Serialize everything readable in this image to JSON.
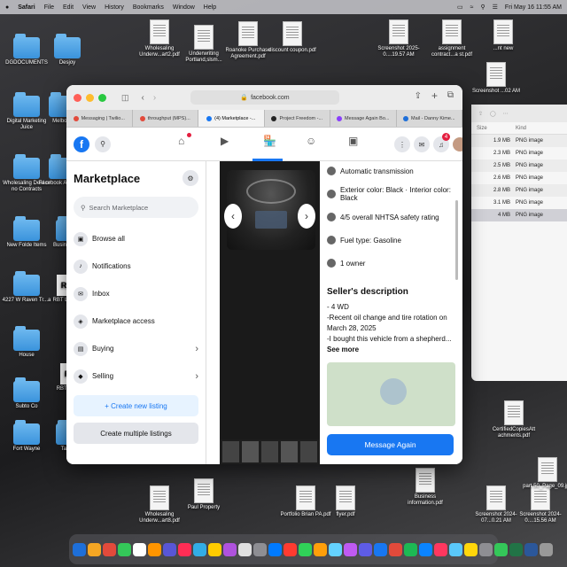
{
  "menubar": {
    "apple": "",
    "app": "Safari",
    "items": [
      "File",
      "Edit",
      "View",
      "History",
      "Bookmarks",
      "Window",
      "Help"
    ],
    "clock": "Fri May 16  11:55 AM"
  },
  "desktop": {
    "icons_left": [
      {
        "label": "DGDOCUMENTS",
        "kind": "folder"
      },
      {
        "label": "Desjoy",
        "kind": "folder"
      },
      {
        "label": "Digital Marketing Juice",
        "kind": "folder"
      },
      {
        "label": "Melbour",
        "kind": "folder"
      },
      {
        "label": "Wholesaling Deal or no Contracts",
        "kind": "folder"
      },
      {
        "label": "Facebook Audience",
        "kind": "folder"
      },
      {
        "label": "New Folde Items",
        "kind": "folder"
      },
      {
        "label": "Business 200",
        "kind": "folder"
      },
      {
        "label": "4227 W Raven Tr...a",
        "kind": "folder"
      },
      {
        "label": "RBT Logo.pdf",
        "kind": "logo"
      },
      {
        "label": "House",
        "kind": "folder"
      },
      {
        "label": "RBT Logo.jpg",
        "kind": "logo"
      },
      {
        "label": "Subto Co",
        "kind": "folder"
      },
      {
        "label": "Fort Wayne",
        "kind": "folder"
      },
      {
        "label": "Taiwan",
        "kind": "folder"
      },
      {
        "label": "sample.csv",
        "kind": "doc"
      }
    ],
    "icons_top": [
      {
        "label": "Wholesaling Underw...art2.pdf"
      },
      {
        "label": "Underwriting Portland,slsm..."
      },
      {
        "label": "Roanoke Purchase Agreement.pdf"
      },
      {
        "label": "discount coupon.pdf"
      },
      {
        "label": "Screenshot 2025-0....19.57 AM"
      },
      {
        "label": "assignment contract...a st.pdf"
      },
      {
        "label": "...nt new"
      },
      {
        "label": "Screenshot ...02 AM"
      }
    ],
    "icons_bottom": [
      {
        "label": "Wholesaling Underw...art8.pdf"
      },
      {
        "label": "Paul Property"
      },
      {
        "label": "Portfolio Brian PA.pdf"
      },
      {
        "label": "flyer.pdf"
      },
      {
        "label": "Business information.pdf"
      },
      {
        "label": "Screenshot 2024-07...0.21 AM"
      },
      {
        "label": "Screenshot 2024-0....15.56 AM"
      },
      {
        "label": "CertifiedCopiesAtt achments.pdf"
      },
      {
        "label": "part 50_Page_09.jpg"
      }
    ]
  },
  "safari": {
    "url": "facebook.com",
    "tabs": [
      {
        "label": "Messaging | Twilio...",
        "color": "#e24a3b"
      },
      {
        "label": "throughput (MPS)...",
        "color": "#e24a3b"
      },
      {
        "label": "(4) Marketplace -...",
        "color": "#1877f2",
        "active": true
      },
      {
        "label": "Project Freedom -...",
        "color": "#222"
      },
      {
        "label": "Message Again Bo...",
        "color": "#8a3ffc"
      },
      {
        "label": "Mail - Danny Kime...",
        "color": "#1e6fd9"
      }
    ]
  },
  "facebook": {
    "notif_count": "4",
    "marketplace": {
      "title": "Marketplace",
      "search_placeholder": "Search Marketplace",
      "menu": [
        {
          "label": "Browse all",
          "icon": "store-icon"
        },
        {
          "label": "Notifications",
          "icon": "bell-icon"
        },
        {
          "label": "Inbox",
          "icon": "inbox-icon"
        },
        {
          "label": "Marketplace access",
          "icon": "shield-icon"
        },
        {
          "label": "Buying",
          "icon": "bag-icon",
          "chevron": true
        },
        {
          "label": "Selling",
          "icon": "tag-icon",
          "chevron": true
        }
      ],
      "create_new": "+ Create new listing",
      "create_multiple": "Create multiple listings"
    },
    "details": [
      {
        "text": "Automatic transmission",
        "icon": "transmission-icon"
      },
      {
        "text": "Exterior color: Black · Interior color: Black",
        "icon": "paint-icon"
      },
      {
        "text": "4/5 overall NHTSA safety rating",
        "icon": "star-icon"
      },
      {
        "text": "Fuel type: Gasoline",
        "icon": "fuel-icon"
      },
      {
        "text": "1 owner",
        "icon": "person-icon"
      }
    ],
    "seller_description_heading": "Seller's description",
    "description_lines": [
      "- 4 WD",
      "-Recent oil change and tire rotation on March 28, 2025",
      "-I bought this vehicle from a shepherd..."
    ],
    "see_more": "See more",
    "message_button": "Message Again"
  },
  "finder": {
    "headers": {
      "size": "Size",
      "kind": "Kind"
    },
    "rows": [
      {
        "size": "1.9 MB",
        "kind": "PNG image"
      },
      {
        "size": "2.3 MB",
        "kind": "PNG image"
      },
      {
        "size": "2.5 MB",
        "kind": "PNG image"
      },
      {
        "size": "2.6 MB",
        "kind": "PNG image"
      },
      {
        "size": "2.8 MB",
        "kind": "PNG image"
      },
      {
        "size": "3.1 MB",
        "kind": "PNG image"
      },
      {
        "size": "4 MB",
        "kind": "PNG image",
        "selected": true
      }
    ]
  },
  "dock_icon_count": 32
}
